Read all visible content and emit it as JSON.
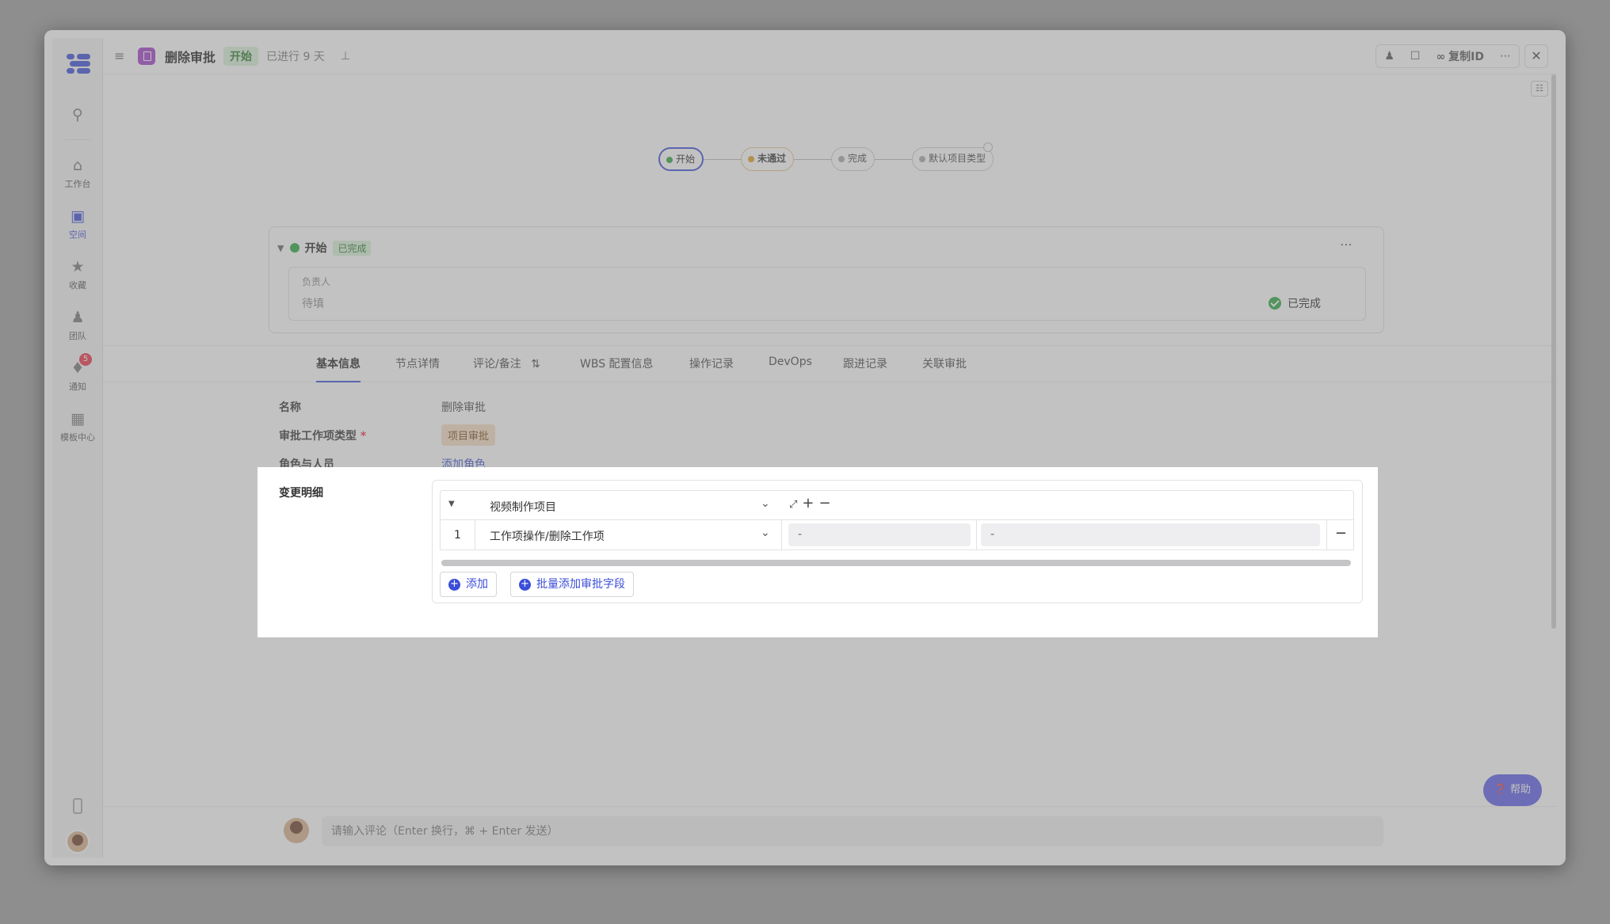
{
  "rail": {
    "items": [
      {
        "label": "工作台",
        "icon": "home-icon"
      },
      {
        "label": "空间",
        "icon": "space-icon"
      },
      {
        "label": "收藏",
        "icon": "star-icon"
      },
      {
        "label": "团队",
        "icon": "team-icon"
      },
      {
        "label": "通知",
        "icon": "bell-icon",
        "badge": "5"
      },
      {
        "label": "模板中心",
        "icon": "grid-icon"
      }
    ]
  },
  "header": {
    "title": "删除审批",
    "state": "开始",
    "elapsed": "已进行 9 天",
    "copy_id": "复制ID"
  },
  "flow": {
    "nodes": [
      "开始",
      "未通过",
      "完成",
      "默认项目类型"
    ]
  },
  "node_card": {
    "name": "开始",
    "tag": "已完成",
    "owner_label": "负责人",
    "owner_value": "待填",
    "status": "已完成"
  },
  "tabs": [
    "基本信息",
    "节点详情",
    "评论/备注",
    "WBS 配置信息",
    "操作记录",
    "DevOps",
    "跟进记录",
    "关联审批"
  ],
  "info": {
    "name_label": "名称",
    "name_value": "删除审批",
    "type_label": "审批工作项类型",
    "type_required": "*",
    "type_value": "项目审批",
    "role_label": "角色与人员",
    "role_link": "添加角色",
    "change_label": "变更明细"
  },
  "change_table": {
    "project": "视频制作项目",
    "rows": [
      {
        "index": "1",
        "operation": "工作项操作/删除工作项",
        "col2": "-",
        "col3": "-"
      }
    ],
    "add_label": "添加",
    "batch_add_label": "批量添加审批字段"
  },
  "comment": {
    "placeholder": "请输入评论（Enter 换行，⌘ + Enter 发送）"
  },
  "help_label": "帮助",
  "colors": {
    "accent": "#3b4ed8",
    "success": "#29a83e",
    "app_icon": "#a23ec9"
  }
}
